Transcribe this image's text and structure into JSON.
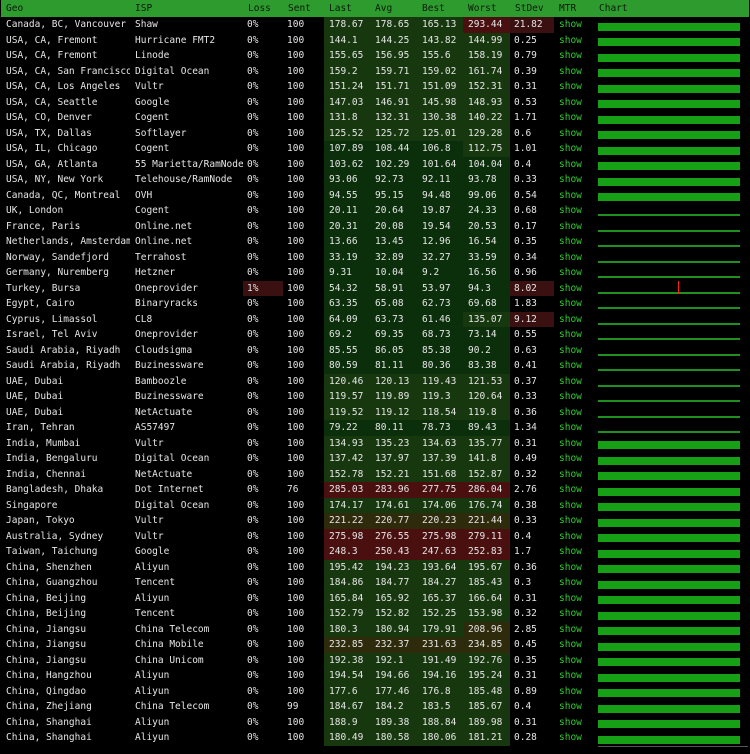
{
  "columns": [
    "Geo",
    "ISP",
    "Loss",
    "Sent",
    "Last",
    "Avg",
    "Best",
    "Worst",
    "StDev",
    "MTR",
    "Chart"
  ],
  "mtr_label": "show",
  "colors": {
    "header": "#2e9b2e",
    "good": "#0b2e0b",
    "mid": "#1b3d0f",
    "bad": "#4a1010",
    "link": "#33cc33",
    "bar": "#16a016",
    "spike": "#ff2020"
  },
  "rows": [
    {
      "geo": "Canada, BC, Vancouver",
      "isp": "Shaw",
      "loss": "0%",
      "sent": "100",
      "last": "178.67",
      "avg": "178.65",
      "best": "165.13",
      "worst": "293.44",
      "stdev": "21.82",
      "bar": "full"
    },
    {
      "geo": "USA, CA, Fremont",
      "isp": "Hurricane FMT2",
      "loss": "0%",
      "sent": "100",
      "last": "144.1",
      "avg": "144.25",
      "best": "143.82",
      "worst": "144.99",
      "stdev": "0.25",
      "bar": "full"
    },
    {
      "geo": "USA, CA, Fremont",
      "isp": "Linode",
      "loss": "0%",
      "sent": "100",
      "last": "155.65",
      "avg": "156.95",
      "best": "155.6",
      "worst": "158.19",
      "stdev": "0.79",
      "bar": "full"
    },
    {
      "geo": "USA, CA, San Francisco",
      "isp": "Digital Ocean",
      "loss": "0%",
      "sent": "100",
      "last": "159.2",
      "avg": "159.71",
      "best": "159.02",
      "worst": "161.74",
      "stdev": "0.39",
      "bar": "full"
    },
    {
      "geo": "USA, CA, Los Angeles",
      "isp": "Vultr",
      "loss": "0%",
      "sent": "100",
      "last": "151.24",
      "avg": "151.71",
      "best": "151.09",
      "worst": "152.31",
      "stdev": "0.31",
      "bar": "full"
    },
    {
      "geo": "USA, CA, Seattle",
      "isp": "Google",
      "loss": "0%",
      "sent": "100",
      "last": "147.03",
      "avg": "146.91",
      "best": "145.98",
      "worst": "148.93",
      "stdev": "0.53",
      "bar": "full"
    },
    {
      "geo": "USA, CO, Denver",
      "isp": "Cogent",
      "loss": "0%",
      "sent": "100",
      "last": "131.8",
      "avg": "132.31",
      "best": "130.38",
      "worst": "140.22",
      "stdev": "1.71",
      "bar": "full"
    },
    {
      "geo": "USA, TX, Dallas",
      "isp": "Softlayer",
      "loss": "0%",
      "sent": "100",
      "last": "125.52",
      "avg": "125.72",
      "best": "125.01",
      "worst": "129.28",
      "stdev": "0.6",
      "bar": "full"
    },
    {
      "geo": "USA, IL, Chicago",
      "isp": "Cogent",
      "loss": "0%",
      "sent": "100",
      "last": "107.89",
      "avg": "108.44",
      "best": "106.8",
      "worst": "112.75",
      "stdev": "1.01",
      "bar": "full"
    },
    {
      "geo": "USA, GA, Atlanta",
      "isp": "55 Marietta/RamNode",
      "loss": "0%",
      "sent": "100",
      "last": "103.62",
      "avg": "102.29",
      "best": "101.64",
      "worst": "104.04",
      "stdev": "0.4",
      "bar": "full"
    },
    {
      "geo": "USA, NY, New York",
      "isp": "Telehouse/RamNode",
      "loss": "0%",
      "sent": "100",
      "last": "93.06",
      "avg": "92.73",
      "best": "92.11",
      "worst": "93.78",
      "stdev": "0.33",
      "bar": "full"
    },
    {
      "geo": "Canada, QC, Montreal",
      "isp": "OVH",
      "loss": "0%",
      "sent": "100",
      "last": "94.55",
      "avg": "95.15",
      "best": "94.48",
      "worst": "99.06",
      "stdev": "0.54",
      "bar": "full"
    },
    {
      "geo": "UK, London",
      "isp": "Cogent",
      "loss": "0%",
      "sent": "100",
      "last": "20.11",
      "avg": "20.64",
      "best": "19.87",
      "worst": "24.33",
      "stdev": "0.68",
      "bar": "thin"
    },
    {
      "geo": "France, Paris",
      "isp": "Online.net",
      "loss": "0%",
      "sent": "100",
      "last": "20.31",
      "avg": "20.08",
      "best": "19.54",
      "worst": "20.53",
      "stdev": "0.17",
      "bar": "thin"
    },
    {
      "geo": "Netherlands, Amsterdam",
      "isp": "Online.net",
      "loss": "0%",
      "sent": "100",
      "last": "13.66",
      "avg": "13.45",
      "best": "12.96",
      "worst": "16.54",
      "stdev": "0.35",
      "bar": "thin"
    },
    {
      "geo": "Norway, Sandefjord",
      "isp": "Terrahost",
      "loss": "0%",
      "sent": "100",
      "last": "33.19",
      "avg": "32.89",
      "best": "32.27",
      "worst": "33.59",
      "stdev": "0.34",
      "bar": "thin"
    },
    {
      "geo": "Germany, Nuremberg",
      "isp": "Hetzner",
      "loss": "0%",
      "sent": "100",
      "last": "9.31",
      "avg": "10.04",
      "best": "9.2",
      "worst": "16.56",
      "stdev": "0.96",
      "bar": "thin"
    },
    {
      "geo": "Turkey, Bursa",
      "isp": "Oneprovider",
      "loss": "1%",
      "sent": "100",
      "last": "54.32",
      "avg": "58.91",
      "best": "53.97",
      "worst": "94.3",
      "stdev": "8.02",
      "bar": "thin",
      "spike": true
    },
    {
      "geo": "Egypt, Cairo",
      "isp": "Binaryracks",
      "loss": "0%",
      "sent": "100",
      "last": "63.35",
      "avg": "65.08",
      "best": "62.73",
      "worst": "69.68",
      "stdev": "1.83",
      "bar": "thin"
    },
    {
      "geo": "Cyprus, Limassol",
      "isp": "CL8",
      "loss": "0%",
      "sent": "100",
      "last": "64.09",
      "avg": "63.73",
      "best": "61.46",
      "worst": "135.07",
      "stdev": "9.12",
      "bar": "thin"
    },
    {
      "geo": "Israel, Tel Aviv",
      "isp": "Oneprovider",
      "loss": "0%",
      "sent": "100",
      "last": "69.2",
      "avg": "69.35",
      "best": "68.73",
      "worst": "73.14",
      "stdev": "0.55",
      "bar": "thin"
    },
    {
      "geo": "Saudi Arabia, Riyadh",
      "isp": "Cloudsigma",
      "loss": "0%",
      "sent": "100",
      "last": "85.55",
      "avg": "86.05",
      "best": "85.38",
      "worst": "90.2",
      "stdev": "0.63",
      "bar": "thin"
    },
    {
      "geo": "Saudi Arabia, Riyadh",
      "isp": "Buzinessware",
      "loss": "0%",
      "sent": "100",
      "last": "80.59",
      "avg": "81.11",
      "best": "80.36",
      "worst": "83.38",
      "stdev": "0.41",
      "bar": "thin"
    },
    {
      "geo": "UAE, Dubai",
      "isp": "Bamboozle",
      "loss": "0%",
      "sent": "100",
      "last": "120.46",
      "avg": "120.13",
      "best": "119.43",
      "worst": "121.53",
      "stdev": "0.37",
      "bar": "thin"
    },
    {
      "geo": "UAE, Dubai",
      "isp": "Buzinessware",
      "loss": "0%",
      "sent": "100",
      "last": "119.57",
      "avg": "119.89",
      "best": "119.3",
      "worst": "120.64",
      "stdev": "0.33",
      "bar": "thin"
    },
    {
      "geo": "UAE, Dubai",
      "isp": "NetActuate",
      "loss": "0%",
      "sent": "100",
      "last": "119.52",
      "avg": "119.12",
      "best": "118.54",
      "worst": "119.8",
      "stdev": "0.36",
      "bar": "thin"
    },
    {
      "geo": "Iran, Tehran",
      "isp": "AS57497",
      "loss": "0%",
      "sent": "100",
      "last": "79.22",
      "avg": "80.11",
      "best": "78.73",
      "worst": "89.43",
      "stdev": "1.34",
      "bar": "thin"
    },
    {
      "geo": "India, Mumbai",
      "isp": "Vultr",
      "loss": "0%",
      "sent": "100",
      "last": "134.93",
      "avg": "135.23",
      "best": "134.63",
      "worst": "135.77",
      "stdev": "0.31",
      "bar": "full"
    },
    {
      "geo": "India, Bengaluru",
      "isp": "Digital Ocean",
      "loss": "0%",
      "sent": "100",
      "last": "137.42",
      "avg": "137.97",
      "best": "137.39",
      "worst": "141.8",
      "stdev": "0.49",
      "bar": "full"
    },
    {
      "geo": "India, Chennai",
      "isp": "NetActuate",
      "loss": "0%",
      "sent": "100",
      "last": "152.78",
      "avg": "152.21",
      "best": "151.68",
      "worst": "152.87",
      "stdev": "0.32",
      "bar": "full"
    },
    {
      "geo": "Bangladesh, Dhaka",
      "isp": "Dot Internet",
      "loss": "0%",
      "sent": "76",
      "last": "285.03",
      "avg": "283.96",
      "best": "277.75",
      "worst": "286.04",
      "stdev": "2.76",
      "bar": "full"
    },
    {
      "geo": "Singapore",
      "isp": "Digital Ocean",
      "loss": "0%",
      "sent": "100",
      "last": "174.17",
      "avg": "174.61",
      "best": "174.06",
      "worst": "176.74",
      "stdev": "0.38",
      "bar": "full"
    },
    {
      "geo": "Japan, Tokyo",
      "isp": "Vultr",
      "loss": "0%",
      "sent": "100",
      "last": "221.22",
      "avg": "220.77",
      "best": "220.23",
      "worst": "221.44",
      "stdev": "0.33",
      "bar": "full"
    },
    {
      "geo": "Australia, Sydney",
      "isp": "Vultr",
      "loss": "0%",
      "sent": "100",
      "last": "275.98",
      "avg": "276.55",
      "best": "275.98",
      "worst": "279.11",
      "stdev": "0.4",
      "bar": "full"
    },
    {
      "geo": "Taiwan, Taichung",
      "isp": "Google",
      "loss": "0%",
      "sent": "100",
      "last": "248.3",
      "avg": "250.43",
      "best": "247.63",
      "worst": "252.83",
      "stdev": "1.7",
      "bar": "full"
    },
    {
      "geo": "China, Shenzhen",
      "isp": "Aliyun",
      "loss": "0%",
      "sent": "100",
      "last": "195.42",
      "avg": "194.23",
      "best": "193.64",
      "worst": "195.67",
      "stdev": "0.36",
      "bar": "full"
    },
    {
      "geo": "China, Guangzhou",
      "isp": "Tencent",
      "loss": "0%",
      "sent": "100",
      "last": "184.86",
      "avg": "184.77",
      "best": "184.27",
      "worst": "185.43",
      "stdev": "0.3",
      "bar": "full"
    },
    {
      "geo": "China, Beijing",
      "isp": "Aliyun",
      "loss": "0%",
      "sent": "100",
      "last": "165.84",
      "avg": "165.92",
      "best": "165.37",
      "worst": "166.64",
      "stdev": "0.31",
      "bar": "full"
    },
    {
      "geo": "China, Beijing",
      "isp": "Tencent",
      "loss": "0%",
      "sent": "100",
      "last": "152.79",
      "avg": "152.82",
      "best": "152.25",
      "worst": "153.98",
      "stdev": "0.32",
      "bar": "full"
    },
    {
      "geo": "China, Jiangsu",
      "isp": "China Telecom",
      "loss": "0%",
      "sent": "100",
      "last": "180.3",
      "avg": "180.94",
      "best": "179.91",
      "worst": "208.96",
      "stdev": "2.85",
      "bar": "full"
    },
    {
      "geo": "China, Jiangsu",
      "isp": "China Mobile",
      "loss": "0%",
      "sent": "100",
      "last": "232.85",
      "avg": "232.37",
      "best": "231.63",
      "worst": "234.85",
      "stdev": "0.45",
      "bar": "full"
    },
    {
      "geo": "China, Jiangsu",
      "isp": "China Unicom",
      "loss": "0%",
      "sent": "100",
      "last": "192.38",
      "avg": "192.1",
      "best": "191.49",
      "worst": "192.76",
      "stdev": "0.35",
      "bar": "full"
    },
    {
      "geo": "China, Hangzhou",
      "isp": "Aliyun",
      "loss": "0%",
      "sent": "100",
      "last": "194.54",
      "avg": "194.66",
      "best": "194.16",
      "worst": "195.24",
      "stdev": "0.31",
      "bar": "full"
    },
    {
      "geo": "China, Qingdao",
      "isp": "Aliyun",
      "loss": "0%",
      "sent": "100",
      "last": "177.6",
      "avg": "177.46",
      "best": "176.8",
      "worst": "185.48",
      "stdev": "0.89",
      "bar": "full"
    },
    {
      "geo": "China, Zhejiang",
      "isp": "China Telecom",
      "loss": "0%",
      "sent": "99",
      "last": "184.67",
      "avg": "184.2",
      "best": "183.5",
      "worst": "185.67",
      "stdev": "0.4",
      "bar": "full"
    },
    {
      "geo": "China, Shanghai",
      "isp": "Aliyun",
      "loss": "0%",
      "sent": "100",
      "last": "188.9",
      "avg": "189.38",
      "best": "188.84",
      "worst": "189.98",
      "stdev": "0.31",
      "bar": "full"
    },
    {
      "geo": "China, Shanghai",
      "isp": "Aliyun",
      "loss": "0%",
      "sent": "100",
      "last": "180.49",
      "avg": "180.58",
      "best": "180.06",
      "worst": "181.21",
      "stdev": "0.28",
      "bar": "full"
    }
  ]
}
